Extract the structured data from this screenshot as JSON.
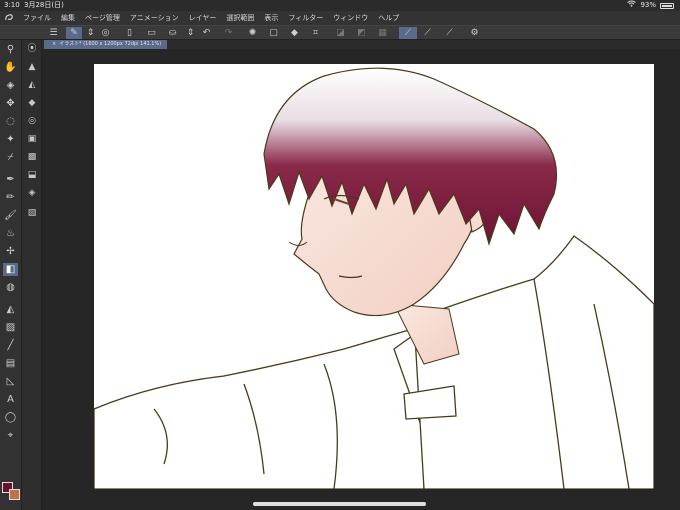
{
  "status": {
    "time": "3:10",
    "date": "3月28日(日)",
    "wifi": "wifi-icon",
    "battery_text": "93%"
  },
  "menu": {
    "items": [
      "ファイル",
      "編集",
      "ページ管理",
      "アニメーション",
      "レイヤー",
      "選択範囲",
      "表示",
      "フィルター",
      "ウィンドウ",
      "ヘルプ"
    ]
  },
  "document": {
    "tab_label": "イラスト* (1600 x 1200px 72dpi 141.1%)",
    "close_glyph": "×"
  },
  "colors": {
    "main_color": "#6b1029",
    "sub_color": "#c0704a",
    "active_tool": "#5a6a8a"
  }
}
